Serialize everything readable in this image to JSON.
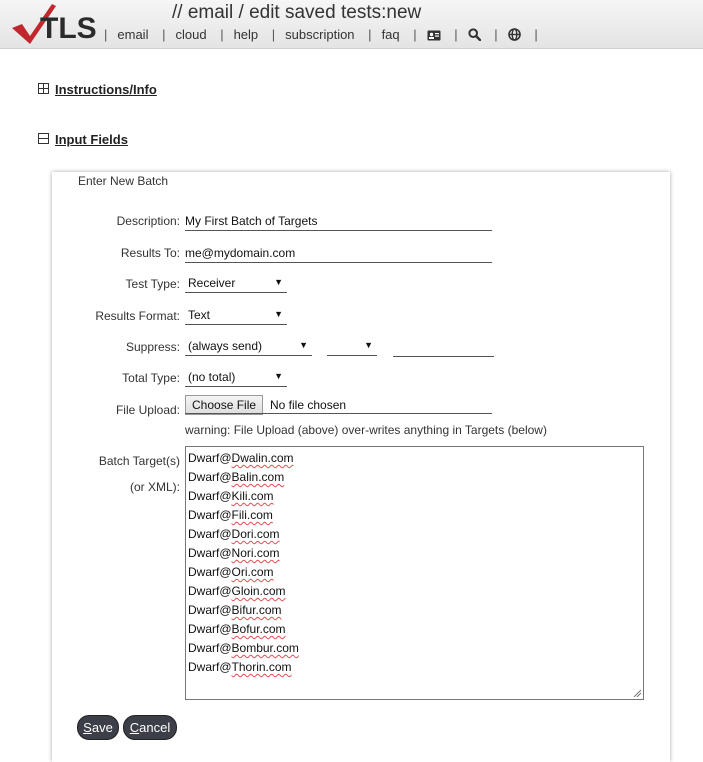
{
  "header": {
    "logo_text": "TLS",
    "title": "// email / edit saved tests:new",
    "nav": [
      "email",
      "cloud",
      "help",
      "subscription",
      "faq"
    ],
    "nav_icons": [
      "id-card-icon",
      "search-icon",
      "globe-icon"
    ]
  },
  "sections": {
    "instructions": "Instructions/Info",
    "input_fields": "Input Fields"
  },
  "form": {
    "title": "Enter New Batch",
    "description_label": "Description:",
    "description_value": "My First Batch of Targets",
    "results_to_label": "Results To:",
    "results_to_value": "me@mydomain.com",
    "test_type_label": "Test Type:",
    "test_type_value": "Receiver",
    "results_format_label": "Results Format:",
    "results_format_value": "Text",
    "suppress_label": "Suppress:",
    "suppress_value": "(always send)",
    "suppress_value2": "",
    "suppress_value3": "",
    "total_type_label": "Total Type:",
    "total_type_value": "(no total)",
    "file_upload_label": "File Upload:",
    "file_button": "Choose File",
    "file_status": "No file chosen",
    "warning": "warning: File Upload (above) over-writes anything in Targets (below)",
    "targets_label_1": "Batch Target(s)",
    "targets_label_2": "(or XML):",
    "targets": [
      {
        "prefix": "Dwarf@",
        "name": "Dwalin.com"
      },
      {
        "prefix": "Dwarf@",
        "name": "Balin.com"
      },
      {
        "prefix": "Dwarf@",
        "name": "Kili.com"
      },
      {
        "prefix": "Dwarf@",
        "name": "Fili.com"
      },
      {
        "prefix": "Dwarf@",
        "name": "Dori.com"
      },
      {
        "prefix": "Dwarf@",
        "name": "Nori.com"
      },
      {
        "prefix": "Dwarf@",
        "name": "Ori.com"
      },
      {
        "prefix": "Dwarf@",
        "name": "Gloin.com"
      },
      {
        "prefix": "Dwarf@",
        "name": "Bifur.com"
      },
      {
        "prefix": "Dwarf@",
        "name": "Bofur.com"
      },
      {
        "prefix": "Dwarf@",
        "name": "Bombur.com"
      },
      {
        "prefix": "Dwarf@",
        "name": "Thorin.com"
      }
    ],
    "save_first": "S",
    "save_rest": "ave",
    "cancel_first": "C",
    "cancel_rest": "ancel"
  },
  "colors": {
    "button_bg": "#3c3f48",
    "logo_red": "#c0282d"
  }
}
